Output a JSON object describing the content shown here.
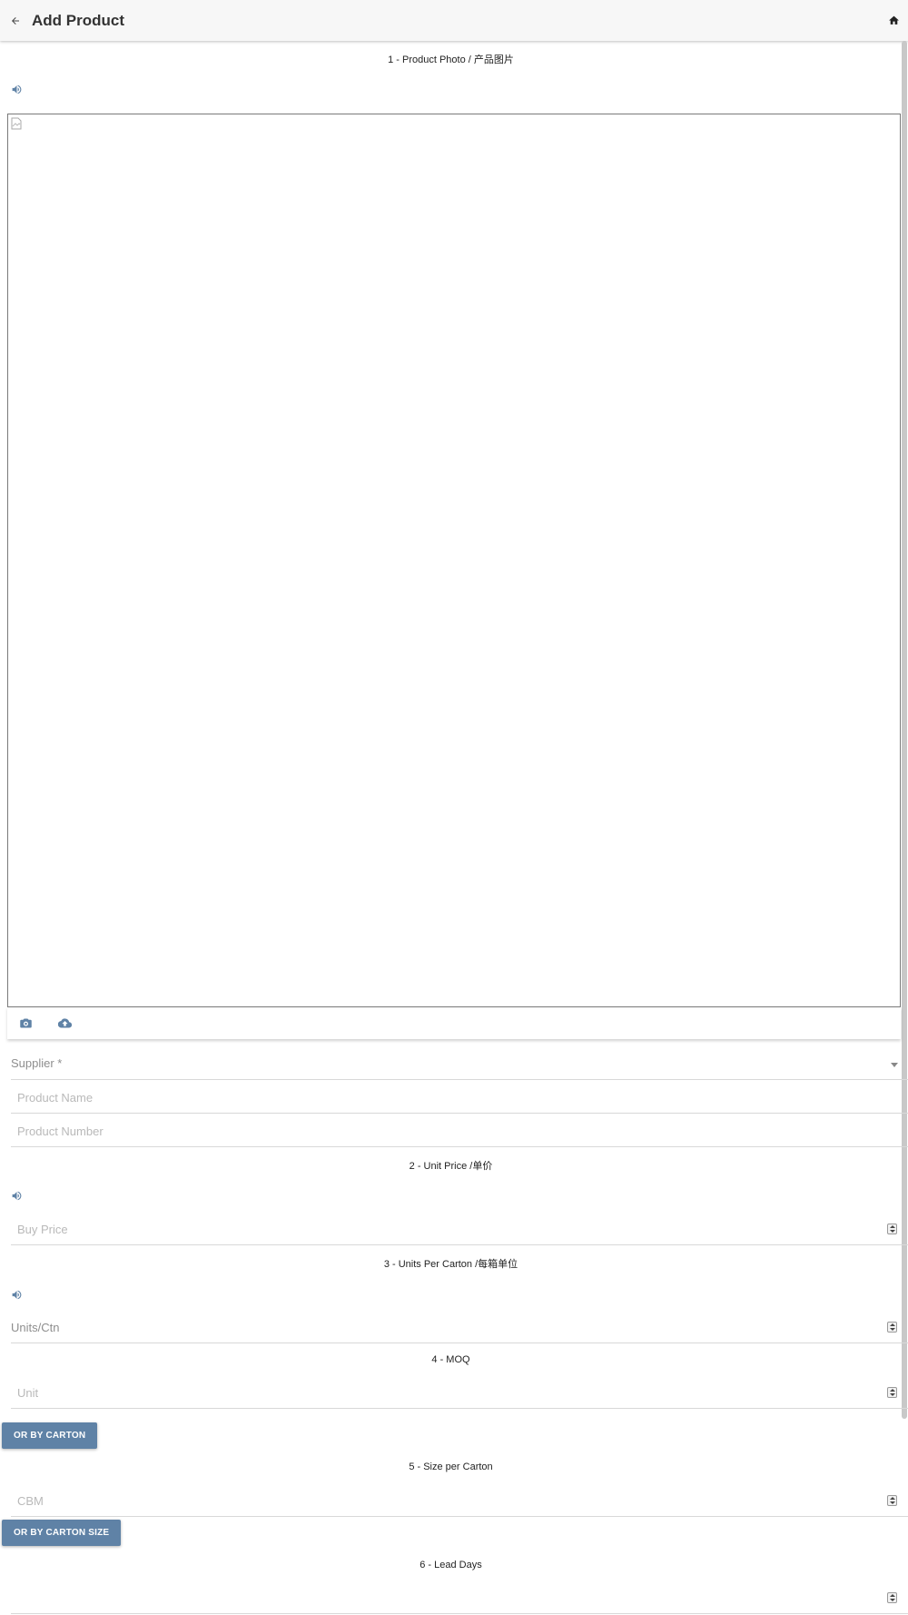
{
  "header": {
    "title": "Add Product",
    "back_icon": "arrow-left-icon",
    "home_icon": "home-icon"
  },
  "sections": {
    "photo": "1 - Product Photo / 产品图片",
    "unit_price": "2 - Unit Price /单价",
    "units_per_carton": "3 - Units Per Carton /每箱单位",
    "moq": "4 - MOQ",
    "size_per_carton": "5 - Size per Carton",
    "lead_days": "6 - Lead Days"
  },
  "fields": {
    "supplier_label": "Supplier *",
    "product_name_placeholder": "Product Name",
    "product_number_placeholder": "Product Number",
    "buy_price_placeholder": "Buy Price",
    "units_ctn_placeholder": "Units/Ctn",
    "unit_placeholder": "Unit",
    "cbm_placeholder": "CBM",
    "lead_days_placeholder": ""
  },
  "buttons": {
    "or_by_carton": "OR BY CARTON",
    "or_by_carton_size": "OR BY CARTON SIZE"
  },
  "colors": {
    "accent": "#5f82a6",
    "header_bg": "#f7f7f7"
  }
}
